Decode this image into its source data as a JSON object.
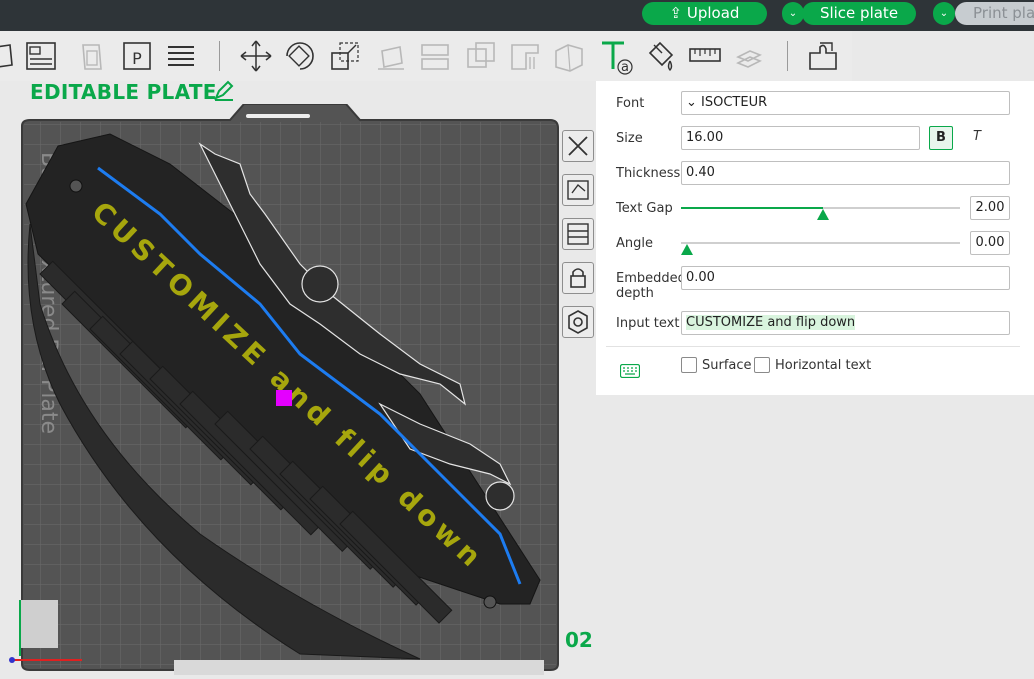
{
  "header": {
    "upload_label": "Upload",
    "slice_label": "Slice plate",
    "print_label": "Print pla"
  },
  "plate": {
    "title": "EDITABLE PLATE",
    "number": "02",
    "bed_label": "Bambu Textured PEI Plate",
    "model_text": "CUSTOMIZE and flip down"
  },
  "panel": {
    "font_label": "Font",
    "font_value": "ISOCTEUR",
    "size_label": "Size",
    "size_value": "16.00",
    "bold_label": "B",
    "italic_label": "T",
    "thickness_label": "Thickness",
    "thickness_value": "0.40",
    "text_gap_label": "Text Gap",
    "text_gap_value": "2.00",
    "text_gap_level": 0.51,
    "angle_label": "Angle",
    "angle_value": "0.00",
    "angle_level": 0.0,
    "embedded_label_1": "Embedded",
    "embedded_label_2": "depth",
    "embedded_value": "0.00",
    "input_text_label": "Input text",
    "input_text_value": "CUSTOMIZE and flip down",
    "surface_label": "Surface",
    "horizontal_label": "Horizontal text"
  },
  "colors": {
    "accent": "#0aa84a",
    "model_text": "#a6a60d",
    "highlight": "#e400ff"
  }
}
